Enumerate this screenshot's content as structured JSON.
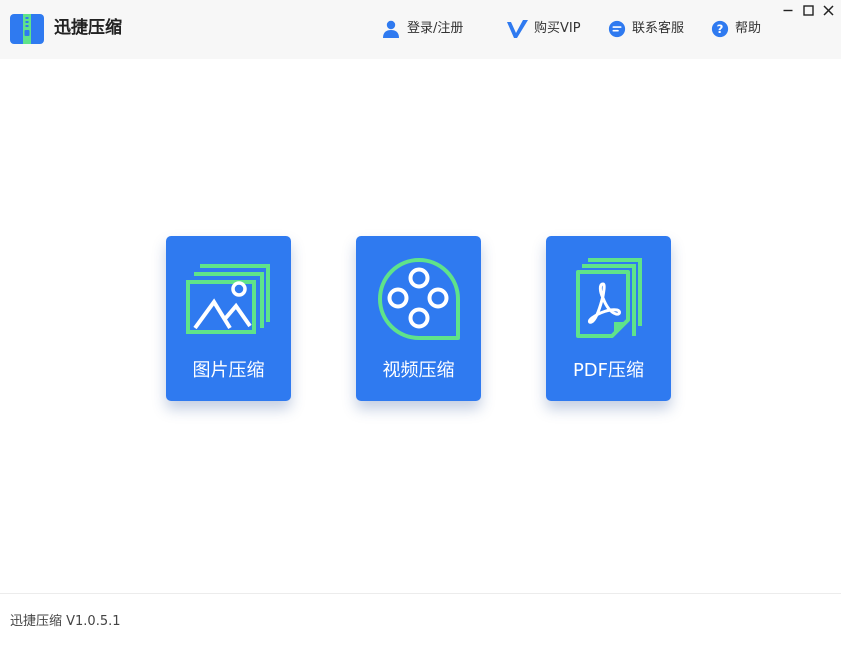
{
  "app": {
    "title": "迅捷压缩",
    "version_text": "迅捷压缩 V1.0.5.1"
  },
  "header": {
    "nav": [
      {
        "label": "登录/注册",
        "icon": "user-icon"
      },
      {
        "label": "购买VIP",
        "icon": "vip-icon"
      },
      {
        "label": "联系客服",
        "icon": "chat-icon"
      },
      {
        "label": "帮助",
        "icon": "help-icon"
      }
    ],
    "window_controls": [
      "minimize-icon",
      "maximize-icon",
      "close-icon"
    ]
  },
  "cards": [
    {
      "label": "图片压缩",
      "icon": "image-stack-icon"
    },
    {
      "label": "视频压缩",
      "icon": "film-reel-icon"
    },
    {
      "label": "PDF压缩",
      "icon": "pdf-document-icon"
    }
  ],
  "colors": {
    "brand_blue": "#2f7af0",
    "icon_green": "#5fe38a",
    "header_bg": "#f7f7f7"
  }
}
